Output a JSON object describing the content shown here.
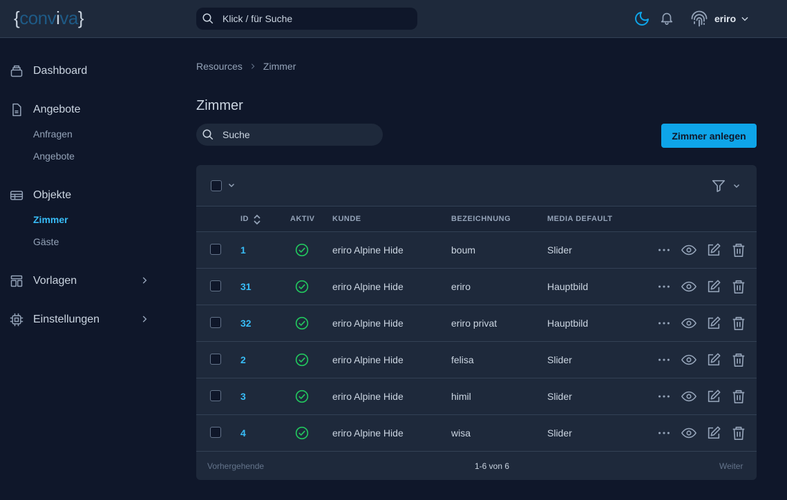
{
  "header": {
    "logo": {
      "open": "{",
      "part1": "conv",
      "part2": "i",
      "part3": "va",
      "close": "}"
    },
    "search_placeholder": "Klick / für Suche",
    "user_name": "eriro"
  },
  "sidebar": {
    "dashboard": "Dashboard",
    "angebote": "Angebote",
    "anfragen": "Anfragen",
    "angebote_sub": "Angebote",
    "objekte": "Objekte",
    "zimmer": "Zimmer",
    "gaeste": "Gäste",
    "vorlagen": "Vorlagen",
    "einstellungen": "Einstellungen"
  },
  "breadcrumb": {
    "root": "Resources",
    "current": "Zimmer"
  },
  "page": {
    "title": "Zimmer",
    "search_placeholder": "Suche",
    "create_label": "Zimmer anlegen"
  },
  "table": {
    "columns": {
      "id": "ID",
      "aktiv": "AKTIV",
      "kunde": "KUNDE",
      "bezeichnung": "BEZEICHNUNG",
      "media": "MEDIA DEFAULT"
    },
    "rows": [
      {
        "id": "1",
        "kunde": "eriro Alpine Hide",
        "bezeichnung": "boum",
        "media": "Slider"
      },
      {
        "id": "31",
        "kunde": "eriro Alpine Hide",
        "bezeichnung": "eriro",
        "media": "Hauptbild"
      },
      {
        "id": "32",
        "kunde": "eriro Alpine Hide",
        "bezeichnung": "eriro privat",
        "media": "Hauptbild"
      },
      {
        "id": "2",
        "kunde": "eriro Alpine Hide",
        "bezeichnung": "felisa",
        "media": "Slider"
      },
      {
        "id": "3",
        "kunde": "eriro Alpine Hide",
        "bezeichnung": "himil",
        "media": "Slider"
      },
      {
        "id": "4",
        "kunde": "eriro Alpine Hide",
        "bezeichnung": "wisa",
        "media": "Slider"
      }
    ]
  },
  "pagination": {
    "prev": "Vorhergehende",
    "info": "1-6 von 6",
    "next": "Weiter"
  },
  "colors": {
    "accent": "#0ea5e9",
    "link": "#38bdf8",
    "active_status": "#22c55e"
  }
}
